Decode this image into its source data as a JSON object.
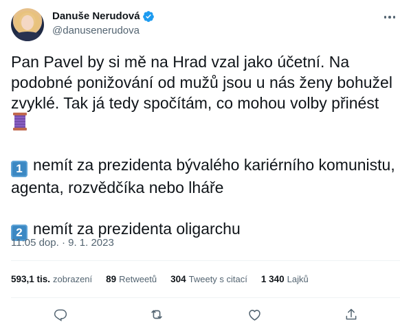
{
  "author": {
    "name": "Danuše Nerudová",
    "handle": "@danusenerudova"
  },
  "tweet": {
    "paragraph1": "Pan Pavel by si mě na Hrad vzal jako účetní. Na podobné ponižování od mužů jsou u nás ženy bohužel zvyklé. Tak já tedy spočítám, co mohou volby přinést",
    "point1_key": "1",
    "point1_text": "nemít za prezidenta bývalého kariérního komunistu, agenta, rozvědčíka nebo lháře",
    "point2_key": "2",
    "point2_text": "nemít za prezidenta oligarchu"
  },
  "timestamp": "11:05 dop. · 9. 1. 2023",
  "stats": {
    "views_num": "593,1 tis.",
    "views_label": "zobrazení",
    "retweets_num": "89",
    "retweets_label": "Retweetů",
    "quotes_num": "304",
    "quotes_label": "Tweety s citací",
    "likes_num": "1 340",
    "likes_label": "Lajků"
  },
  "icons": {
    "verified": "verified-badge-icon",
    "more": "more-icon",
    "spool": "spool-of-thread-emoji",
    "reply": "reply-icon",
    "retweet": "retweet-icon",
    "like": "heart-icon",
    "share": "share-icon"
  },
  "colors": {
    "text": "#0f1419",
    "secondary": "#536471",
    "accent": "#1d9bf0",
    "keycap": "#3b88c3",
    "divider": "#eff3f4"
  }
}
